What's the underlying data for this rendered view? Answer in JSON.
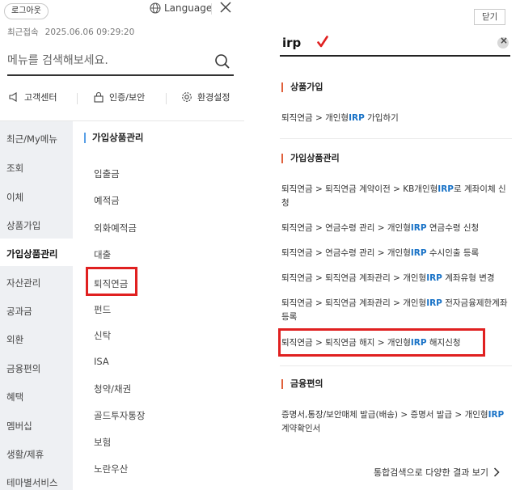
{
  "left": {
    "logout_label": "로그아웃",
    "language_label": "Language",
    "last_login_label": "최근접속",
    "last_login_time": "2025.06.06 09:29:20",
    "search_placeholder": "메뉴를 검색해보세요.",
    "quick_links": [
      "고객센터",
      "인증/보안",
      "환경설정"
    ],
    "categories": [
      "최근/My메뉴",
      "조회",
      "이체",
      "상품가입",
      "가입상품관리",
      "자산관리",
      "공과금",
      "외환",
      "금융편의",
      "혜택",
      "멤버십",
      "생활/제휴",
      "테마별서비스"
    ],
    "active_category_index": 4,
    "sub_heading": "가입상품관리",
    "sub_items": [
      "입출금",
      "예적금",
      "외화예적금",
      "대출",
      "퇴직연금",
      "펀드",
      "신탁",
      "ISA",
      "청약/채권",
      "골드투자통장",
      "보험",
      "노란우산"
    ],
    "highlighted_sub_index": 4
  },
  "right": {
    "close_label": "닫기",
    "query": "irp",
    "sections": [
      {
        "heading": "상품가입",
        "results": [
          [
            "퇴직연금 > 개인형",
            "IRP",
            " 가입하기"
          ]
        ]
      },
      {
        "heading": "가입상품관리",
        "results": [
          [
            "퇴직연금 > 퇴직연금 계약이전 > KB개인형",
            "IRP",
            "로 계좌이체 신청"
          ],
          [
            "퇴직연금 > 연금수령 관리 > 개인형",
            "IRP",
            " 연금수령 신청"
          ],
          [
            "퇴직연금 > 연금수령 관리 > 개인형",
            "IRP",
            " 수시인출 등록"
          ],
          [
            "퇴직연금 > 퇴직연금 계좌관리 > 개인형",
            "IRP",
            " 계좌유형 변경"
          ],
          [
            "퇴직연금 > 퇴직연금 계좌관리 > 개인형",
            "IRP",
            " 전자금융제한계좌 등록"
          ],
          [
            "퇴직연금 > 퇴직연금 해지 > 개인형",
            "IRP",
            " 해지신청"
          ]
        ]
      },
      {
        "heading": "금융편의",
        "results": [
          [
            "증명서,통장/보안매체 발급(배송) > 증명서 발급 > 개인형",
            "IRP",
            " 계약확인서"
          ]
        ]
      }
    ],
    "more_label": "통합검색으로 다양한 결과 보기",
    "accent_color": "#1a73c7",
    "highlight_color": "#e02020"
  }
}
